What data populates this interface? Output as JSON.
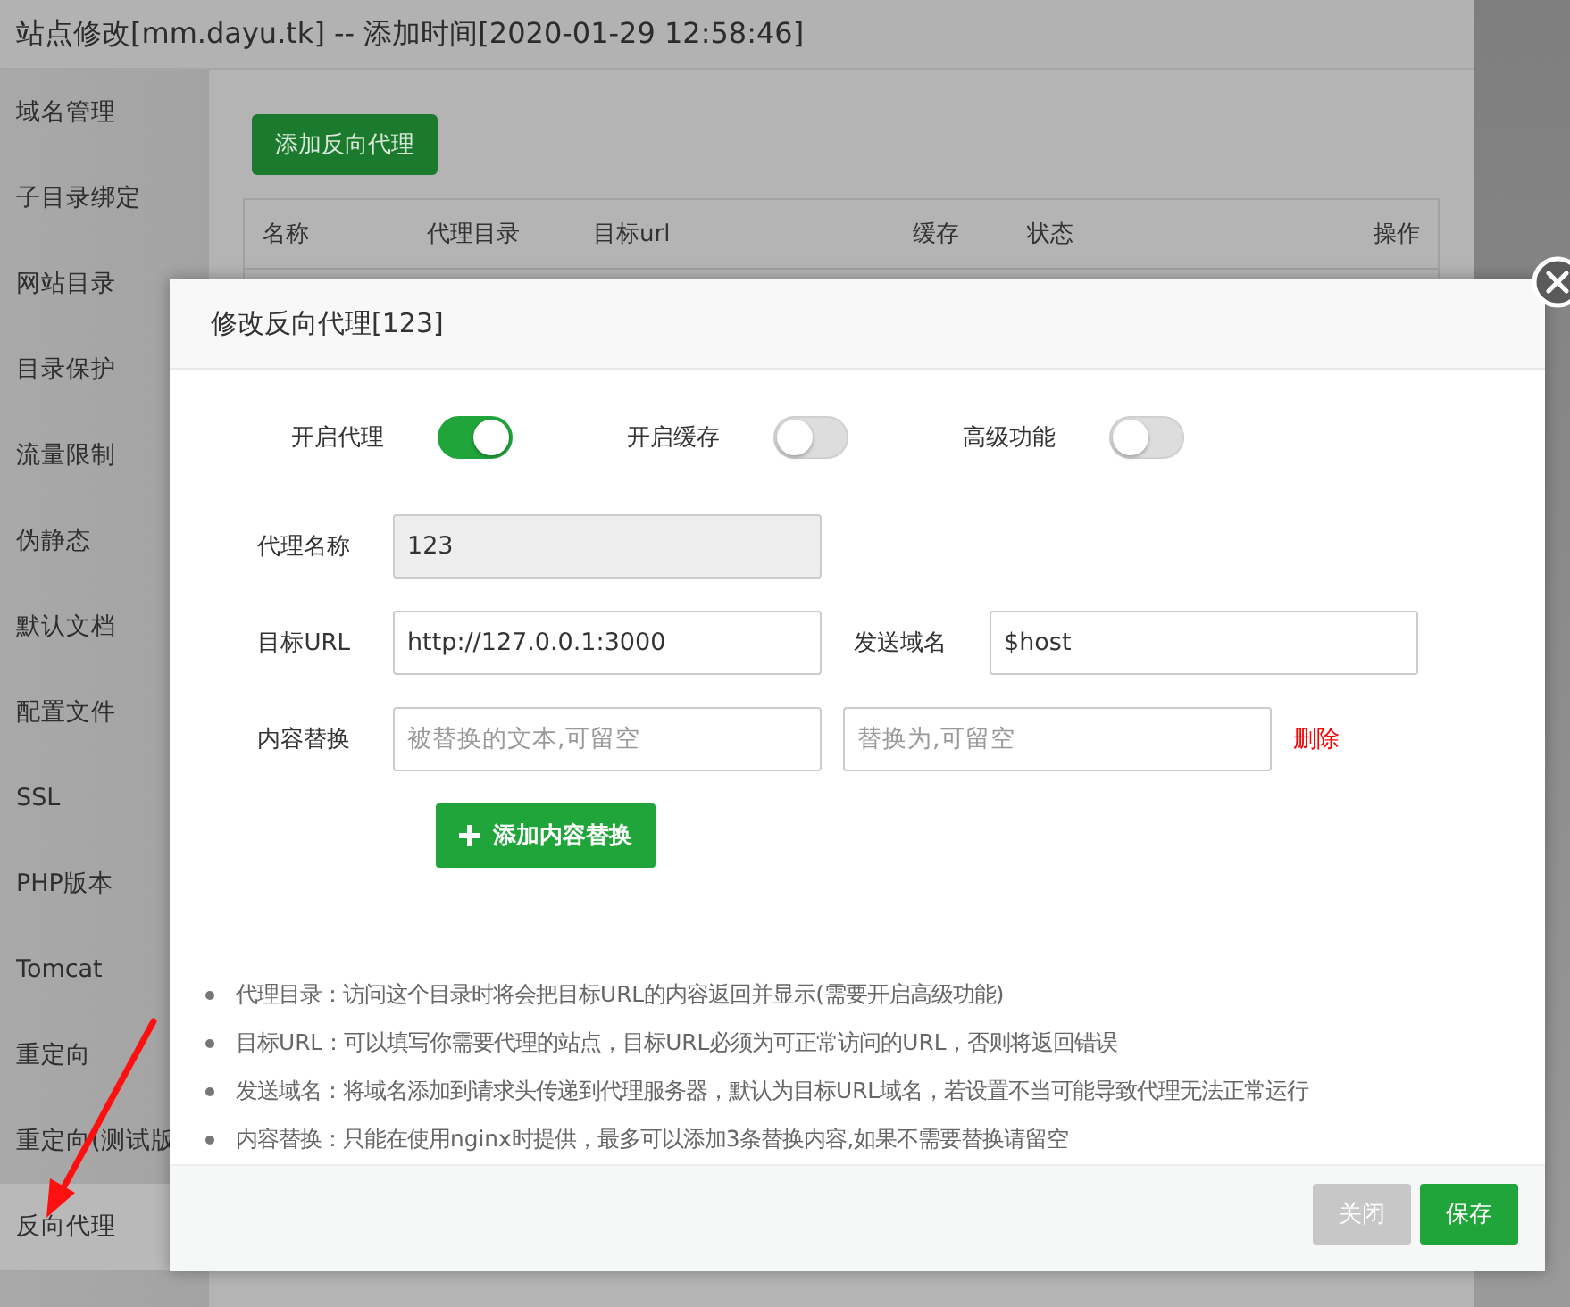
{
  "window": {
    "title": "站点修改[mm.dayu.tk] -- 添加时间[2020-01-29 12:58:46]"
  },
  "sidebar": {
    "items": [
      {
        "label": "域名管理",
        "selected": false
      },
      {
        "label": "子目录绑定",
        "selected": false
      },
      {
        "label": "网站目录",
        "selected": false
      },
      {
        "label": "目录保护",
        "selected": false
      },
      {
        "label": "流量限制",
        "selected": false
      },
      {
        "label": "伪静态",
        "selected": false
      },
      {
        "label": "默认文档",
        "selected": false
      },
      {
        "label": "配置文件",
        "selected": false
      },
      {
        "label": "SSL",
        "selected": false
      },
      {
        "label": "PHP版本",
        "selected": false
      },
      {
        "label": "Tomcat",
        "selected": false
      },
      {
        "label": "重定向",
        "selected": false
      },
      {
        "label": "重定向(测试版",
        "selected": false
      },
      {
        "label": "反向代理",
        "selected": true
      }
    ]
  },
  "content": {
    "add_button": "添加反向代理",
    "table": {
      "columns": [
        "名称",
        "代理目录",
        "目标url",
        "缓存",
        "状态",
        "操作"
      ]
    }
  },
  "dialog": {
    "title": "修改反向代理[123]",
    "switches": [
      {
        "label": "开启代理",
        "on": true
      },
      {
        "label": "开启缓存",
        "on": false
      },
      {
        "label": "高级功能",
        "on": false
      }
    ],
    "proxy_name": {
      "label": "代理名称",
      "value": "123",
      "disabled": true
    },
    "target_url": {
      "label": "目标URL",
      "value": "http://127.0.0.1:3000"
    },
    "send_domain": {
      "label": "发送域名",
      "value": "$host"
    },
    "content_replace": {
      "label": "内容替换",
      "fields": [
        {
          "placeholder": "被替换的文本,可留空"
        },
        {
          "placeholder": "替换为,可留空"
        }
      ],
      "delete": "删除"
    },
    "add_replace_button": "添加内容替换",
    "tips": [
      "代理目录：访问这个目录时将会把目标URL的内容返回并显示(需要开启高级功能)",
      "目标URL：可以填写你需要代理的站点，目标URL必须为可正常访问的URL，否则将返回错误",
      "发送域名：将域名添加到请求头传递到代理服务器，默认为目标URL域名，若设置不当可能导致代理无法正常运行",
      "内容替换：只能在使用nginx时提供，最多可以添加3条替换内容,如果不需要替换请留空"
    ],
    "buttons": [
      {
        "label": "关闭",
        "kind": "secondary"
      },
      {
        "label": "保存",
        "kind": "primary"
      }
    ]
  }
}
